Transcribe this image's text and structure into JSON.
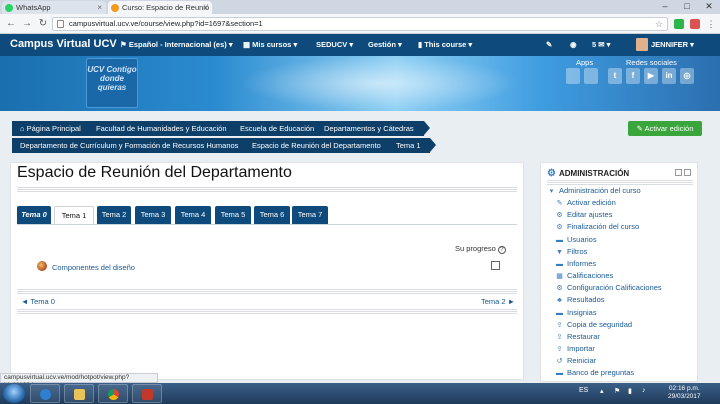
{
  "browser": {
    "tabs": [
      {
        "label": "WhatsApp",
        "icon": "whatsapp-icon"
      },
      {
        "label": "Curso: Espacio de Reunió",
        "icon": "moodle-icon"
      }
    ],
    "url": "campusvirtual.ucv.ve/course/view.php?id=1697&section=1"
  },
  "navbar": {
    "brand": "Campus Virtual UCV",
    "language": "Español - Internacional (es)",
    "my_courses": "Mis cursos",
    "seducv": "SEDUCV",
    "gestion": "Gestión",
    "this_course": "This course",
    "messages_count": "5",
    "user": "JENNIFER"
  },
  "banner": {
    "logo_text": "UCV Contigo donde quieras",
    "apps_label": "Apps",
    "social_label": "Redes sociales"
  },
  "breadcrumb": [
    "Página Principal",
    "Facultad de Humanidades y Educación",
    "Escuela de Educación",
    "Departamentos y Cátedras",
    "Departamento de Currículum y Formación de Recursos Humanos",
    "Espacio de Reunión del Departamento",
    "Tema 1"
  ],
  "edit_button": "Activar edición",
  "page": {
    "title": "Espacio de Reunión del Departamento",
    "tabs": [
      "Tema 0",
      "Tema 1",
      "Tema 2",
      "Tema 3",
      "Tema 4",
      "Tema 5",
      "Tema 6",
      "Tema 7"
    ],
    "active_tab": "Tema 1",
    "progress_label": "Su progreso",
    "activity": "Componentes del diseño",
    "prev_section": "◄ Tema 0",
    "next_section": "Tema 2 ►"
  },
  "admin": {
    "title": "ADMINISTRACIÓN",
    "root": "Administración del curso",
    "items": [
      {
        "label": "Activar edición",
        "icon": "pencil-icon"
      },
      {
        "label": "Editar ajustes",
        "icon": "gear-icon"
      },
      {
        "label": "Finalización del curso",
        "icon": "gear-icon"
      },
      {
        "label": "Usuarios",
        "icon": "folder-icon"
      },
      {
        "label": "Filtros",
        "icon": "filter-icon"
      },
      {
        "label": "Informes",
        "icon": "folder-icon"
      },
      {
        "label": "Calificaciones",
        "icon": "grid-icon"
      },
      {
        "label": "Configuración Calificaciones",
        "icon": "gear-icon"
      },
      {
        "label": "Resultados",
        "icon": "trophy-icon"
      },
      {
        "label": "Insignias",
        "icon": "folder-icon"
      },
      {
        "label": "Copia de seguridad",
        "icon": "upload-icon"
      },
      {
        "label": "Restaurar",
        "icon": "upload-icon"
      },
      {
        "label": "Importar",
        "icon": "upload-icon"
      },
      {
        "label": "Reiniciar",
        "icon": "undo-icon"
      },
      {
        "label": "Banco de preguntas",
        "icon": "folder-icon"
      }
    ]
  },
  "status_bar": "campusvirtual.ucv.ve/mod/hotpot/view.php?id=111204",
  "taskbar": {
    "lang": "ES",
    "time": "02:16 p.m.",
    "date": "29/03/2017"
  }
}
